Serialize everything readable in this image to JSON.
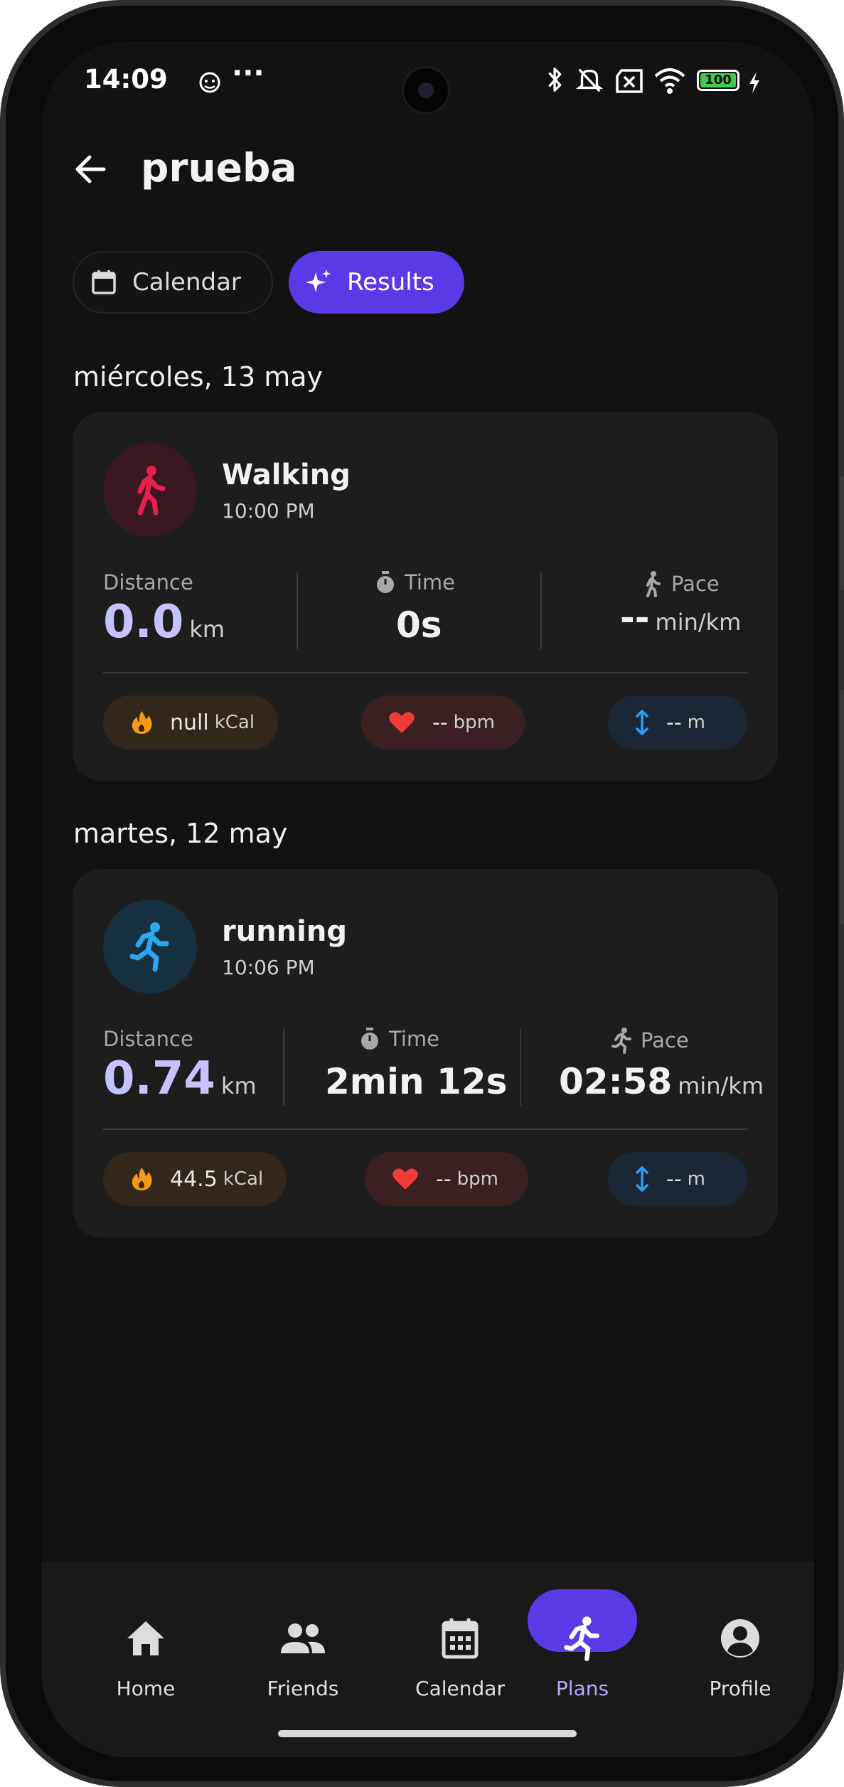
{
  "status_bar": {
    "time": "14:09",
    "dots": "···",
    "battery": "100"
  },
  "header": {
    "title": "prueba"
  },
  "tabs": [
    {
      "label": "Calendar",
      "icon": "calendar-icon",
      "active": false
    },
    {
      "label": "Results",
      "icon": "sparkle-icon",
      "active": true
    }
  ],
  "accent_color": "#5a3ae6",
  "days": [
    {
      "date": "miércoles, 13 may",
      "activity": {
        "name": "Walking",
        "time": "10:00 PM",
        "icon": "walking-icon",
        "icon_color": "#e8204f",
        "distance_label": "Distance",
        "distance_value": "0.0",
        "distance_unit": "km",
        "time_label": "Time",
        "time_value": "0s",
        "pace_label": "Pace",
        "pace_value": "--",
        "pace_unit": "min/km",
        "calories_value": "null",
        "calories_unit": "kCal",
        "heart_value": "--",
        "heart_unit": "bpm",
        "elevation_value": "--",
        "elevation_unit": "m"
      }
    },
    {
      "date": "martes, 12 may",
      "activity": {
        "name": "running",
        "time": "10:06 PM",
        "icon": "running-icon",
        "icon_color": "#2aa8f2",
        "distance_label": "Distance",
        "distance_value": "0.74",
        "distance_unit": "km",
        "time_label": "Time",
        "time_value": "2min 12s",
        "pace_label": "Pace",
        "pace_value": "02:58",
        "pace_unit": "min/km",
        "calories_value": "44.5",
        "calories_unit": "kCal",
        "heart_value": "--",
        "heart_unit": "bpm",
        "elevation_value": "--",
        "elevation_unit": "m"
      }
    }
  ],
  "bottom_nav": [
    {
      "label": "Home",
      "icon": "home-icon"
    },
    {
      "label": "Friends",
      "icon": "friends-icon"
    },
    {
      "label": "Calendar",
      "icon": "calendar-icon"
    },
    {
      "label": "Plans",
      "icon": "running-icon",
      "active": true
    },
    {
      "label": "Profile",
      "icon": "profile-icon"
    }
  ]
}
